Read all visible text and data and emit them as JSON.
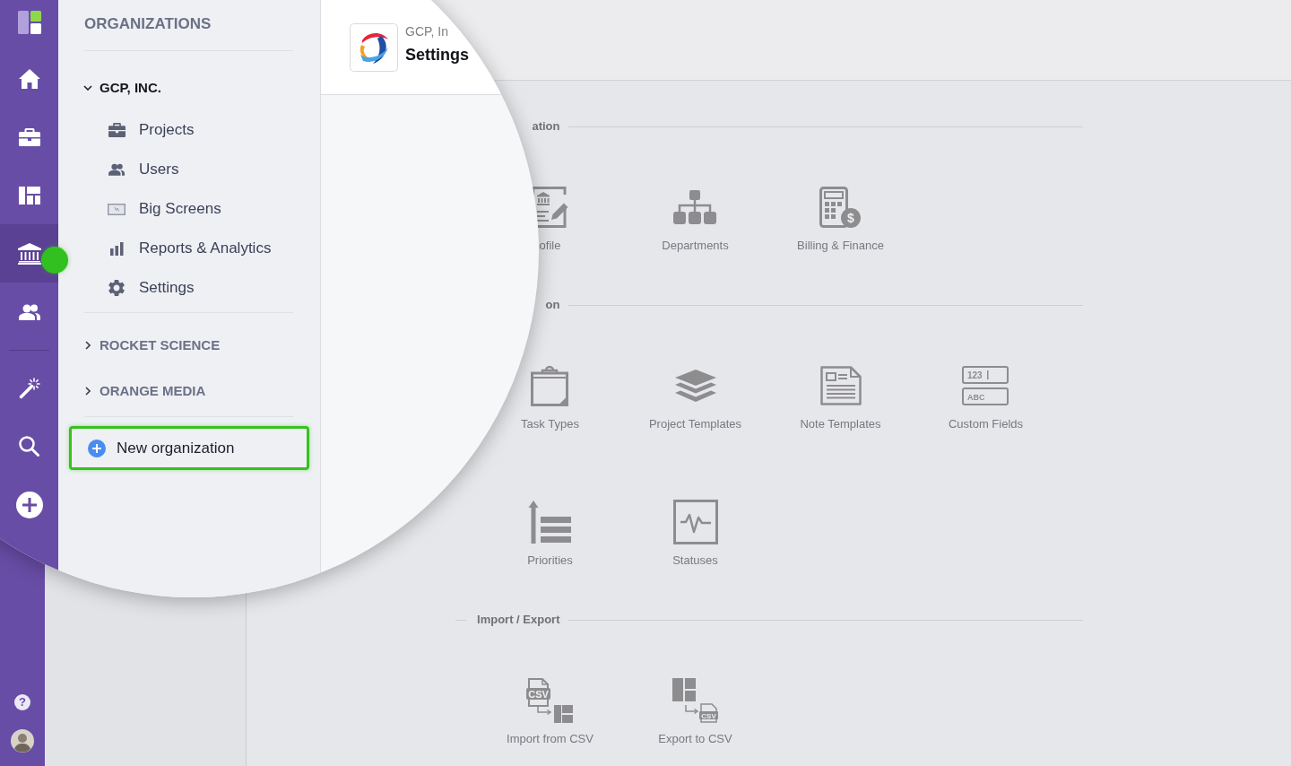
{
  "nav": {
    "items": [
      {
        "kind": "home",
        "selected": false,
        "hotspot": false
      },
      {
        "kind": "projects",
        "selected": false,
        "hotspot": false
      },
      {
        "kind": "boards",
        "selected": false,
        "hotspot": false
      },
      {
        "kind": "organizations",
        "selected": true,
        "hotspot": true
      },
      {
        "kind": "people",
        "selected": false,
        "hotspot": false
      }
    ],
    "tools": [
      {
        "kind": "wand"
      },
      {
        "kind": "search"
      },
      {
        "kind": "add"
      }
    ]
  },
  "panel": {
    "title": "ORGANIZATIONS",
    "organizations": [
      {
        "name": "GCP, INC.",
        "expanded": true,
        "children": [
          {
            "label": "Projects",
            "kind": "projects"
          },
          {
            "label": "Users",
            "kind": "users"
          },
          {
            "label": "Big Screens",
            "kind": "screens"
          },
          {
            "label": "Reports & Analytics",
            "kind": "reports"
          },
          {
            "label": "Settings",
            "kind": "settings"
          }
        ]
      },
      {
        "name": "ROCKET SCIENCE",
        "expanded": false
      },
      {
        "name": "ORANGE MEDIA",
        "expanded": false
      }
    ],
    "new_organization": {
      "label": "New organization",
      "highlighted": true
    }
  },
  "header": {
    "organization": "GCP, In",
    "title": "Settings"
  },
  "sections": [
    {
      "title": "ation",
      "items": [
        {
          "label": "ofile",
          "kind": "profile"
        },
        {
          "label": "Departments",
          "kind": "departments"
        },
        {
          "label": "Billing & Finance",
          "kind": "billing",
          "icon_text": [
            "$"
          ]
        }
      ]
    },
    {
      "title": "on",
      "items": [
        {
          "label": "Task Types",
          "kind": "tasks"
        },
        {
          "label": "Project Templates",
          "kind": "templates"
        },
        {
          "label": "Note Templates",
          "kind": "notes"
        },
        {
          "label": "Custom Fields",
          "kind": "fields",
          "icon_text": [
            "123",
            "ABC"
          ]
        },
        {
          "label": "Priorities",
          "kind": "priorities"
        },
        {
          "label": "Statuses",
          "kind": "statuses"
        }
      ]
    },
    {
      "title": "Import / Export",
      "items": [
        {
          "label": "Import from CSV",
          "kind": "import",
          "icon_text": [
            "CSV"
          ]
        },
        {
          "label": "Export to CSV",
          "kind": "export",
          "icon_text": [
            "CSV"
          ]
        }
      ]
    }
  ],
  "sidebar_footer": {
    "help": "?"
  }
}
